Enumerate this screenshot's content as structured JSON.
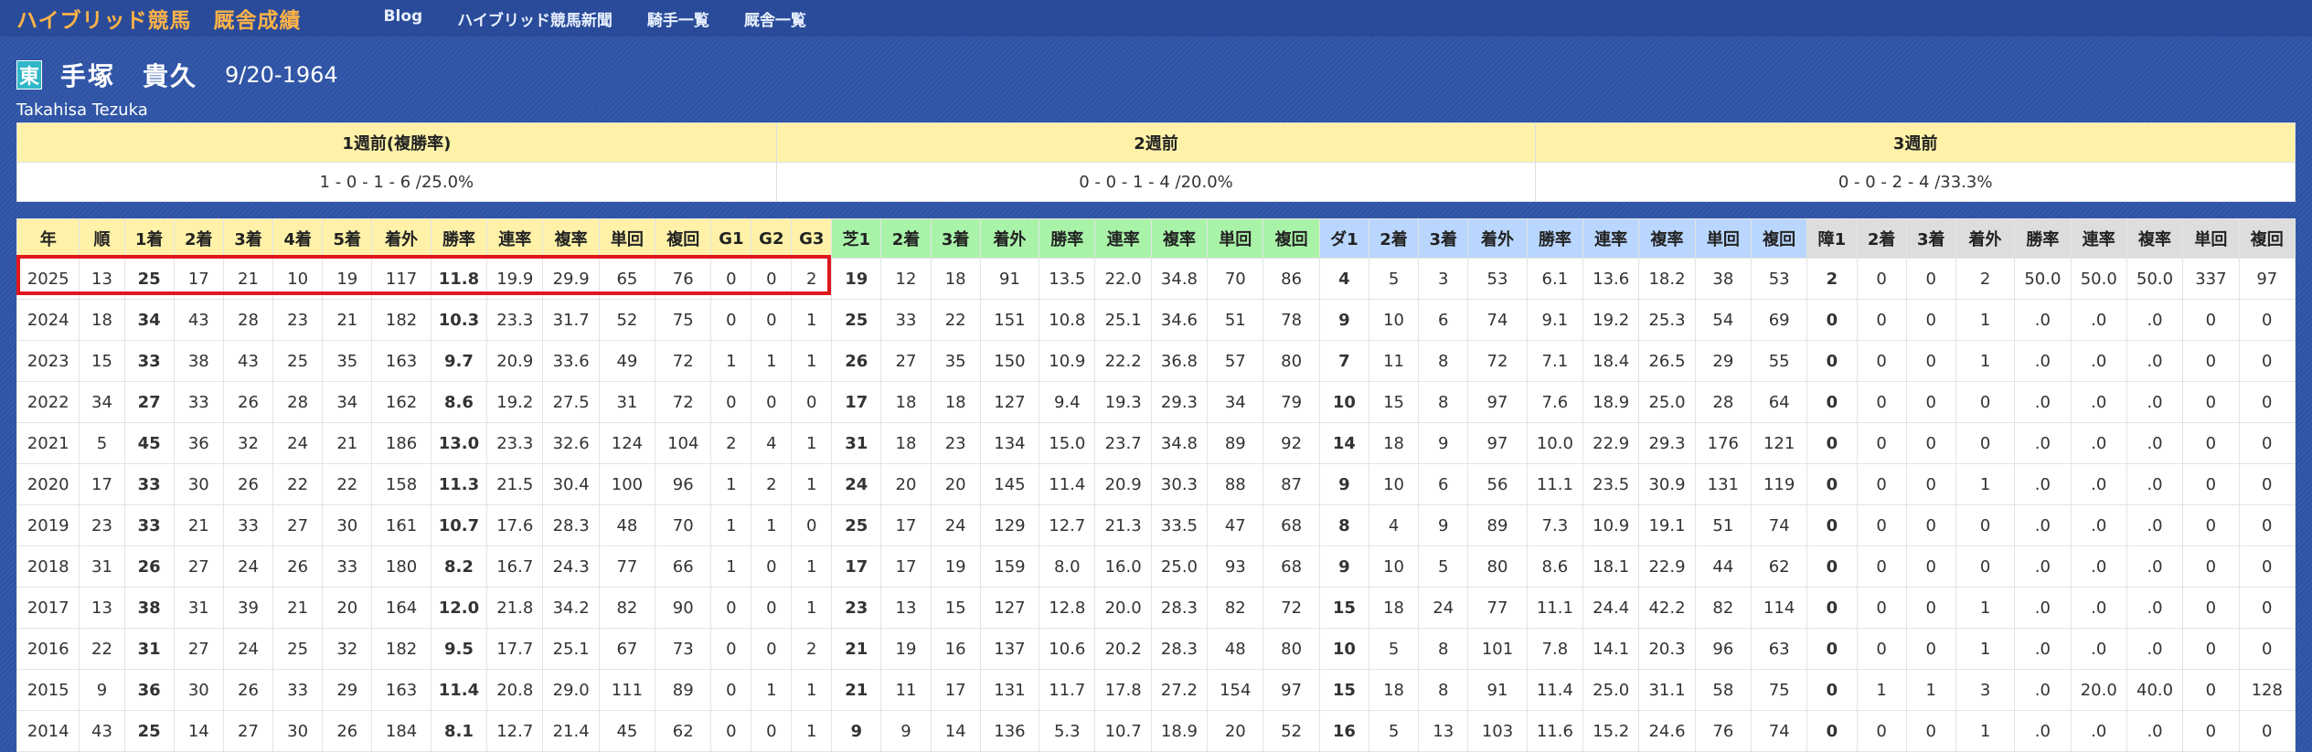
{
  "topbar": {
    "site_title": "ハイブリッド競馬",
    "site_section": "厩舎成績",
    "nav": [
      "Blog",
      "ハイブリッド競馬新聞",
      "騎手一覧",
      "厩舎一覧"
    ]
  },
  "jockey": {
    "region_badge": "東",
    "name": "手塚　貴久",
    "dob": "9/20-1964",
    "name_roman": "Takahisa Tezuka"
  },
  "weeks": {
    "headers": [
      "1週前(複勝率)",
      "2週前",
      "3週前"
    ],
    "values": [
      "1 - 0 - 1 - 6 /25.0%",
      "0 - 0 - 1 - 4 /20.0%",
      "0 - 0 - 2 - 4 /33.3%"
    ]
  },
  "stats": {
    "headers": [
      "年",
      "順",
      "1着",
      "2着",
      "3着",
      "4着",
      "5着",
      "着外",
      "勝率",
      "連率",
      "複率",
      "単回",
      "複回",
      "G1",
      "G2",
      "G3",
      "芝1",
      "2着",
      "3着",
      "着外",
      "勝率",
      "連率",
      "複率",
      "単回",
      "複回",
      "ダ1",
      "2着",
      "3着",
      "着外",
      "勝率",
      "連率",
      "複率",
      "単回",
      "複回",
      "障1",
      "2着",
      "3着",
      "着外",
      "勝率",
      "連率",
      "複率",
      "単回",
      "複回"
    ],
    "rows": [
      [
        "2025",
        "13",
        "25",
        "17",
        "21",
        "10",
        "19",
        "117",
        "11.8",
        "19.9",
        "29.9",
        "65",
        "76",
        "0",
        "0",
        "2",
        "19",
        "12",
        "18",
        "91",
        "13.5",
        "22.0",
        "34.8",
        "70",
        "86",
        "4",
        "5",
        "3",
        "53",
        "6.1",
        "13.6",
        "18.2",
        "38",
        "53",
        "2",
        "0",
        "0",
        "2",
        "50.0",
        "50.0",
        "50.0",
        "337",
        "97"
      ],
      [
        "2024",
        "18",
        "34",
        "43",
        "28",
        "23",
        "21",
        "182",
        "10.3",
        "23.3",
        "31.7",
        "52",
        "75",
        "0",
        "0",
        "1",
        "25",
        "33",
        "22",
        "151",
        "10.8",
        "25.1",
        "34.6",
        "51",
        "78",
        "9",
        "10",
        "6",
        "74",
        "9.1",
        "19.2",
        "25.3",
        "54",
        "69",
        "0",
        "0",
        "0",
        "1",
        ".0",
        ".0",
        ".0",
        "0",
        "0"
      ],
      [
        "2023",
        "15",
        "33",
        "38",
        "43",
        "25",
        "35",
        "163",
        "9.7",
        "20.9",
        "33.6",
        "49",
        "72",
        "1",
        "1",
        "1",
        "26",
        "27",
        "35",
        "150",
        "10.9",
        "22.2",
        "36.8",
        "57",
        "80",
        "7",
        "11",
        "8",
        "72",
        "7.1",
        "18.4",
        "26.5",
        "29",
        "55",
        "0",
        "0",
        "0",
        "1",
        ".0",
        ".0",
        ".0",
        "0",
        "0"
      ],
      [
        "2022",
        "34",
        "27",
        "33",
        "26",
        "28",
        "34",
        "162",
        "8.6",
        "19.2",
        "27.5",
        "31",
        "72",
        "0",
        "0",
        "0",
        "17",
        "18",
        "18",
        "127",
        "9.4",
        "19.3",
        "29.3",
        "34",
        "79",
        "10",
        "15",
        "8",
        "97",
        "7.6",
        "18.9",
        "25.0",
        "28",
        "64",
        "0",
        "0",
        "0",
        "0",
        ".0",
        ".0",
        ".0",
        "0",
        "0"
      ],
      [
        "2021",
        "5",
        "45",
        "36",
        "32",
        "24",
        "21",
        "186",
        "13.0",
        "23.3",
        "32.6",
        "124",
        "104",
        "2",
        "4",
        "1",
        "31",
        "18",
        "23",
        "134",
        "15.0",
        "23.7",
        "34.8",
        "89",
        "92",
        "14",
        "18",
        "9",
        "97",
        "10.0",
        "22.9",
        "29.3",
        "176",
        "121",
        "0",
        "0",
        "0",
        "0",
        ".0",
        ".0",
        ".0",
        "0",
        "0"
      ],
      [
        "2020",
        "17",
        "33",
        "30",
        "26",
        "22",
        "22",
        "158",
        "11.3",
        "21.5",
        "30.4",
        "100",
        "96",
        "1",
        "2",
        "1",
        "24",
        "20",
        "20",
        "145",
        "11.4",
        "20.9",
        "30.3",
        "88",
        "87",
        "9",
        "10",
        "6",
        "56",
        "11.1",
        "23.5",
        "30.9",
        "131",
        "119",
        "0",
        "0",
        "0",
        "1",
        ".0",
        ".0",
        ".0",
        "0",
        "0"
      ],
      [
        "2019",
        "23",
        "33",
        "21",
        "33",
        "27",
        "30",
        "161",
        "10.7",
        "17.6",
        "28.3",
        "48",
        "70",
        "1",
        "1",
        "0",
        "25",
        "17",
        "24",
        "129",
        "12.7",
        "21.3",
        "33.5",
        "47",
        "68",
        "8",
        "4",
        "9",
        "89",
        "7.3",
        "10.9",
        "19.1",
        "51",
        "74",
        "0",
        "0",
        "0",
        "0",
        ".0",
        ".0",
        ".0",
        "0",
        "0"
      ],
      [
        "2018",
        "31",
        "26",
        "27",
        "24",
        "26",
        "33",
        "180",
        "8.2",
        "16.7",
        "24.3",
        "77",
        "66",
        "1",
        "0",
        "1",
        "17",
        "17",
        "19",
        "159",
        "8.0",
        "16.0",
        "25.0",
        "93",
        "68",
        "9",
        "10",
        "5",
        "80",
        "8.6",
        "18.1",
        "22.9",
        "44",
        "62",
        "0",
        "0",
        "0",
        "0",
        ".0",
        ".0",
        ".0",
        "0",
        "0"
      ],
      [
        "2017",
        "13",
        "38",
        "31",
        "39",
        "21",
        "20",
        "164",
        "12.0",
        "21.8",
        "34.2",
        "82",
        "90",
        "0",
        "0",
        "1",
        "23",
        "13",
        "15",
        "127",
        "12.8",
        "20.0",
        "28.3",
        "82",
        "72",
        "15",
        "18",
        "24",
        "77",
        "11.1",
        "24.4",
        "42.2",
        "82",
        "114",
        "0",
        "0",
        "0",
        "1",
        ".0",
        ".0",
        ".0",
        "0",
        "0"
      ],
      [
        "2016",
        "22",
        "31",
        "27",
        "24",
        "25",
        "32",
        "182",
        "9.5",
        "17.7",
        "25.1",
        "67",
        "73",
        "0",
        "0",
        "2",
        "21",
        "19",
        "16",
        "137",
        "10.6",
        "20.2",
        "28.3",
        "48",
        "80",
        "10",
        "5",
        "8",
        "101",
        "7.8",
        "14.1",
        "20.3",
        "96",
        "63",
        "0",
        "0",
        "0",
        "1",
        ".0",
        ".0",
        ".0",
        "0",
        "0"
      ],
      [
        "2015",
        "9",
        "36",
        "30",
        "26",
        "33",
        "29",
        "163",
        "11.4",
        "20.8",
        "29.0",
        "111",
        "89",
        "0",
        "1",
        "1",
        "21",
        "11",
        "17",
        "131",
        "11.7",
        "17.8",
        "27.2",
        "154",
        "97",
        "15",
        "18",
        "8",
        "91",
        "11.4",
        "25.0",
        "31.1",
        "58",
        "75",
        "0",
        "1",
        "1",
        "3",
        ".0",
        "20.0",
        "40.0",
        "0",
        "128"
      ],
      [
        "2014",
        "43",
        "25",
        "14",
        "27",
        "30",
        "26",
        "184",
        "8.1",
        "12.7",
        "21.4",
        "45",
        "62",
        "0",
        "0",
        "1",
        "9",
        "9",
        "14",
        "136",
        "5.3",
        "10.7",
        "18.9",
        "20",
        "52",
        "16",
        "5",
        "13",
        "103",
        "11.6",
        "15.2",
        "24.6",
        "76",
        "74",
        "0",
        "0",
        "0",
        "1",
        ".0",
        ".0",
        ".0",
        "0",
        "0"
      ]
    ]
  }
}
